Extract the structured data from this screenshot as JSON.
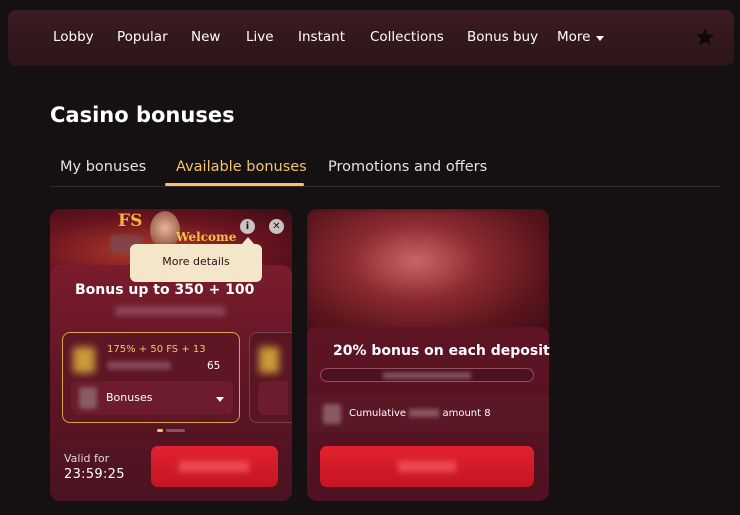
{
  "nav": {
    "items": [
      "Lobby",
      "Popular",
      "New",
      "Live",
      "Instant",
      "Collections",
      "Bonus buy"
    ],
    "more_label": "More",
    "favorites_icon": "star-icon"
  },
  "page_title": "Casino bonuses",
  "tabs": [
    {
      "label": "My bonuses",
      "active": false
    },
    {
      "label": "Available bonuses",
      "active": true
    },
    {
      "label": "Promotions and offers",
      "active": false
    }
  ],
  "card1": {
    "hero_fs": "FS",
    "hero_welcome": "Welcome",
    "title": "Bonus up to 350      + 100",
    "tooltip": "More details",
    "offer": {
      "line1": "175% + 50 FS + 13",
      "value": "65",
      "select_label": "Bonuses"
    },
    "valid_label": "Valid for",
    "valid_time": "23:59:25"
  },
  "card2": {
    "title": "20% bonus on each deposit",
    "cumulative_left": "Cumulative",
    "cumulative_right": "amount 8"
  },
  "colors": {
    "background": "#151012",
    "accent": "#f2c46b",
    "cta": "#d81a27",
    "card": "#5a1423",
    "tooltip": "#f3e6c9"
  }
}
